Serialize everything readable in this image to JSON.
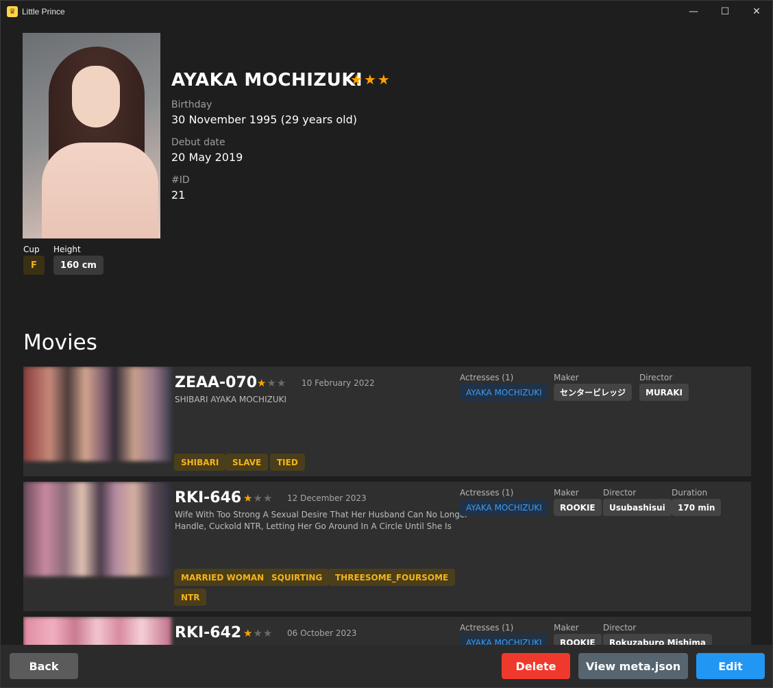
{
  "window": {
    "title": "Little Prince",
    "app_icon": "crown-icon",
    "minimize_glyph": "—",
    "maximize_glyph": "☐",
    "close_glyph": "✕"
  },
  "actress": {
    "name": "AYAKA MOCHIZUKI",
    "rating": 3,
    "rating_max": 3,
    "birthday_label": "Birthday",
    "birthday_value": "30 November 1995 (29 years old)",
    "debut_label": "Debut date",
    "debut_value": "20 May 2019",
    "id_label": "#ID",
    "id_value": "21",
    "cup_label": "Cup",
    "cup_value": "F",
    "height_label": "Height",
    "height_value": "160 cm"
  },
  "movies_title": "Movies",
  "movies": [
    {
      "code": "ZEAA-070",
      "rating": 1,
      "rating_max": 3,
      "date": "10 February 2022",
      "title_lines": [
        "SHIBARI AYAKA MOCHIZUKI"
      ],
      "actresses_label": "Actresses (1)",
      "actress": "AYAKA MOCHIZUKI",
      "maker_label": "Maker",
      "maker": "センタービレッジ",
      "director_label": "Director",
      "director": "MURAKI",
      "tags": [
        "SHIBARI",
        "SLAVE",
        "TIED"
      ]
    },
    {
      "code": "RKI-646",
      "rating": 1,
      "rating_max": 3,
      "date": "12 December 2023",
      "title_lines": [
        "Wife With Too Strong A Sexual Desire That Her Husband Can No Longer",
        "Handle, Cuckold NTR, Letting Her Go Around In A Circle Until She Is"
      ],
      "actresses_label": "Actresses (1)",
      "actress": "AYAKA MOCHIZUKI",
      "maker_label": "Maker",
      "maker": "ROOKIE",
      "director_label": "Director",
      "director": "Usubashisui",
      "duration_label": "Duration",
      "duration": "170 min",
      "tags": [
        "MARRIED WOMAN",
        "SQUIRTING",
        "THREESOME_FOURSOME",
        "NTR"
      ]
    },
    {
      "code": "RKI-642",
      "rating": 1,
      "rating_max": 3,
      "date": "06 October 2023",
      "actresses_label": "Actresses (1)",
      "actress": "AYAKA MOCHIZUKI",
      "maker_label": "Maker",
      "maker": "ROOKIE",
      "director_label": "Director",
      "director": "Rokuzaburo Mishima"
    }
  ],
  "buttons": {
    "back": "Back",
    "delete": "Delete",
    "view_meta": "View meta.json",
    "edit": "Edit"
  },
  "colors": {
    "accent_blue": "#2196f3",
    "danger_red": "#f0392d",
    "star_orange": "#ffa200",
    "tag_yellow": "#f5b31b"
  }
}
